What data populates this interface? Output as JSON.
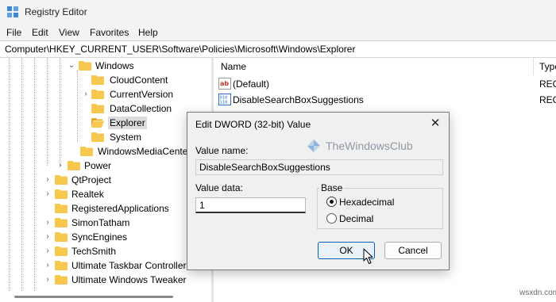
{
  "window": {
    "title": "Registry Editor"
  },
  "menu": [
    "File",
    "Edit",
    "View",
    "Favorites",
    "Help"
  ],
  "address": "Computer\\HKEY_CURRENT_USER\\Software\\Policies\\Microsoft\\Windows\\Explorer",
  "tree": [
    {
      "label": "Windows",
      "expanded": true
    },
    {
      "label": "CloudContent"
    },
    {
      "label": "CurrentVersion",
      "collapsed": true
    },
    {
      "label": "DataCollection"
    },
    {
      "label": "Explorer",
      "selected": true
    },
    {
      "label": "System"
    },
    {
      "label": "WindowsMediaCenter"
    },
    {
      "label": "Power",
      "collapsed": true
    },
    {
      "label": "QtProject",
      "collapsed": true
    },
    {
      "label": "Realtek",
      "collapsed": true
    },
    {
      "label": "RegisteredApplications"
    },
    {
      "label": "SimonTatham",
      "collapsed": true
    },
    {
      "label": "SyncEngines",
      "collapsed": true
    },
    {
      "label": "TechSmith",
      "collapsed": true
    },
    {
      "label": "Ultimate Taskbar Controller",
      "collapsed": true
    },
    {
      "label": "Ultimate Windows Tweaker",
      "collapsed": true
    }
  ],
  "list": {
    "columns": {
      "name": "Name",
      "type": "Type"
    },
    "rows": [
      {
        "icon": "string-value-icon",
        "name": "(Default)",
        "type": "REG"
      },
      {
        "icon": "dword-value-icon",
        "name": "DisableSearchBoxSuggestions",
        "type": "REG"
      }
    ]
  },
  "dialog": {
    "title": "Edit DWORD (32-bit) Value",
    "value_name_label": "Value name:",
    "value_name": "DisableSearchBoxSuggestions",
    "value_data_label": "Value data:",
    "value_data": "1",
    "base_label": "Base",
    "base_options": [
      "Hexadecimal",
      "Decimal"
    ],
    "base_selected": "Hexadecimal",
    "ok_label": "OK",
    "cancel_label": "Cancel"
  },
  "watermark": "TheWindowsClub",
  "credit": "wsxdn.com",
  "colors": {
    "accent": "#005fb8",
    "folder": "#f8c74d",
    "selection": "#dcdcdc"
  }
}
